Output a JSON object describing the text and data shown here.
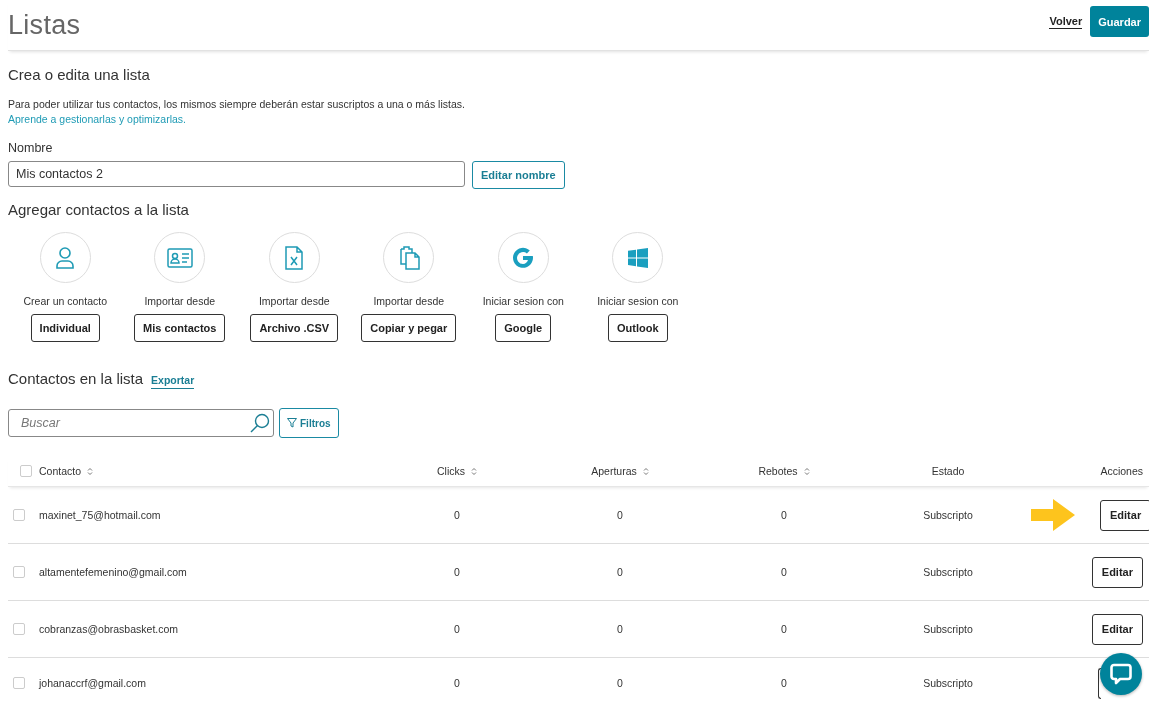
{
  "header": {
    "title": "Listas",
    "back_link": "Volver",
    "save_button": "Guardar"
  },
  "list_form": {
    "heading": "Crea o edita una lista",
    "description": "Para poder utilizar tus contactos, los mismos siempre deberán estar suscriptos a una o más listas.",
    "help_link": "Aprende a gestionarlas y optimizarlas.",
    "name_label": "Nombre",
    "name_value": "Mis contactos 2",
    "rename_button": "Editar nombre"
  },
  "add_contacts": {
    "heading": "Agregar contactos a la lista",
    "options": [
      {
        "kind": "person",
        "caption": "Crear un contacto",
        "button": "Individual"
      },
      {
        "kind": "id-card",
        "caption": "Importar desde",
        "button": "Mis contactos"
      },
      {
        "kind": "spreadsheet",
        "caption": "Importar desde",
        "button": "Archivo .CSV"
      },
      {
        "kind": "clipboard",
        "caption": "Importar desde",
        "button": "Copiar y pegar"
      },
      {
        "kind": "google",
        "caption": "Iniciar sesion con",
        "button": "Google"
      },
      {
        "kind": "windows",
        "caption": "Iniciar sesion con",
        "button": "Outlook"
      }
    ]
  },
  "contacts": {
    "heading": "Contactos en la lista",
    "export_link": "Exportar",
    "search": {
      "placeholder": "Buscar"
    },
    "filter_button": "Filtros",
    "table": {
      "select_all_checked": false,
      "columns": [
        {
          "label": "Contacto",
          "sortable": true
        },
        {
          "label": "Clicks",
          "sortable": true
        },
        {
          "label": "Aperturas",
          "sortable": true
        },
        {
          "label": "Rebotes",
          "sortable": true
        },
        {
          "label": "Estado",
          "sortable": false
        },
        {
          "label": "Acciones",
          "sortable": false
        }
      ],
      "rows": [
        {
          "checked": false,
          "highlighted": true,
          "cells": [
            "maxinet_75@hotmail.com",
            "0",
            "0",
            "0",
            "Subscripto"
          ],
          "action": "Editar"
        },
        {
          "checked": false,
          "highlighted": false,
          "cells": [
            "altamentefemenino@gmail.com",
            "0",
            "0",
            "0",
            "Subscripto"
          ],
          "action": "Editar"
        },
        {
          "checked": false,
          "highlighted": false,
          "cells": [
            "cobranzas@obrasbasket.com",
            "0",
            "0",
            "0",
            "Subscripto"
          ],
          "action": "Editar"
        },
        {
          "checked": false,
          "highlighted": false,
          "cells": [
            "johanaccrf@gmail.com",
            "0",
            "0",
            "0",
            "Subscripto"
          ]
        }
      ]
    }
  }
}
